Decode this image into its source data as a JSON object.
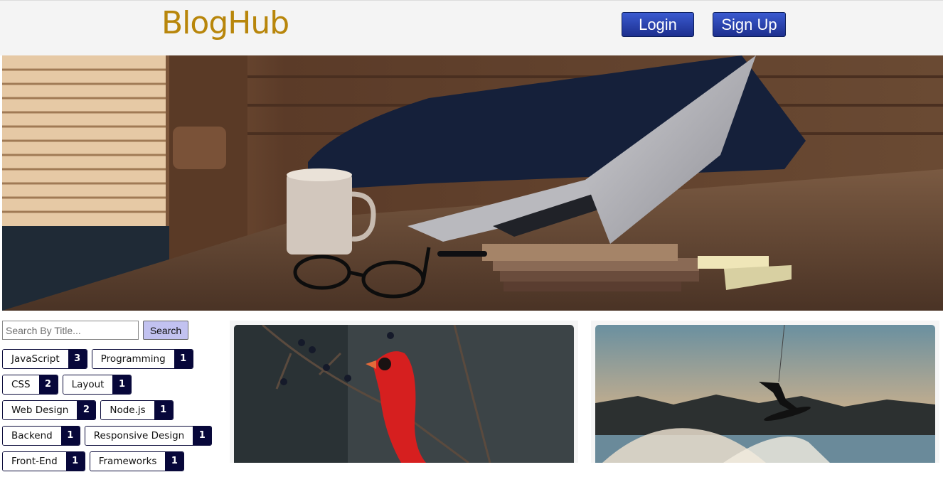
{
  "header": {
    "logo": "BlogHub",
    "login_label": "Login",
    "signup_label": "Sign Up"
  },
  "search": {
    "placeholder": "Search By Title...",
    "value": "",
    "button_label": "Search"
  },
  "tags": [
    [
      {
        "label": "JavaScript",
        "count": "3"
      },
      {
        "label": "Programming",
        "count": "1"
      }
    ],
    [
      {
        "label": "CSS",
        "count": "2"
      },
      {
        "label": "Layout",
        "count": "1"
      }
    ],
    [
      {
        "label": "Web Design",
        "count": "2"
      },
      {
        "label": "Node.js",
        "count": "1"
      }
    ],
    [
      {
        "label": "Backend",
        "count": "1"
      },
      {
        "label": "Responsive Design",
        "count": "1"
      }
    ],
    [
      {
        "label": "Front-End",
        "count": "1"
      },
      {
        "label": "Frameworks",
        "count": "1"
      }
    ]
  ],
  "colors": {
    "brand": "#b8860b",
    "nav_button": "#1d2f8e",
    "tag_count_bg": "#07073a",
    "search_button_bg": "#c2c2f0"
  }
}
